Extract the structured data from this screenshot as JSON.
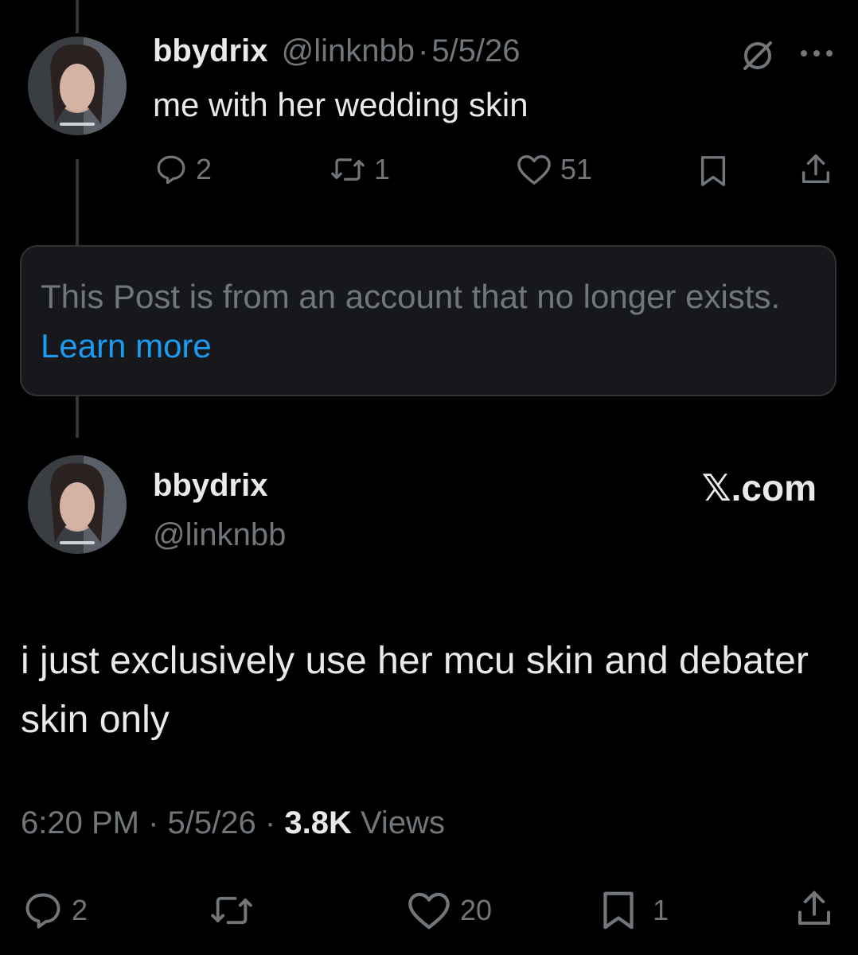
{
  "parent_post": {
    "display_name": "bbydrix",
    "handle": "@linknbb",
    "separator": "·",
    "date": "5/5/26",
    "text": "me with her wedding skin",
    "actions": {
      "replies": "2",
      "reposts": "1",
      "likes": "51"
    },
    "icons": [
      "no-entry-icon",
      "more-icon",
      "reply-icon",
      "repost-icon",
      "like-icon",
      "bookmark-icon",
      "share-icon"
    ]
  },
  "notice": {
    "text": "This Post is from an account that no longer exists.",
    "link": "Learn more"
  },
  "main_post": {
    "display_name": "bbydrix",
    "handle": "@linknbb",
    "source_badge": "𝕏.com",
    "text": "i just exclusively use her mcu skin and debater skin only",
    "time": "6:20 PM",
    "separator": "·",
    "date": "5/5/26",
    "views_count": "3.8K",
    "views_label": "Views",
    "actions": {
      "replies": "2",
      "reposts": "",
      "likes": "20",
      "bookmarks": "1"
    }
  },
  "colors": {
    "background": "#000000",
    "primary_text": "#e7e9ea",
    "secondary_text": "#71767b",
    "link": "#1d9bf0",
    "notice_bg": "#16181c",
    "border": "#2f3336"
  }
}
